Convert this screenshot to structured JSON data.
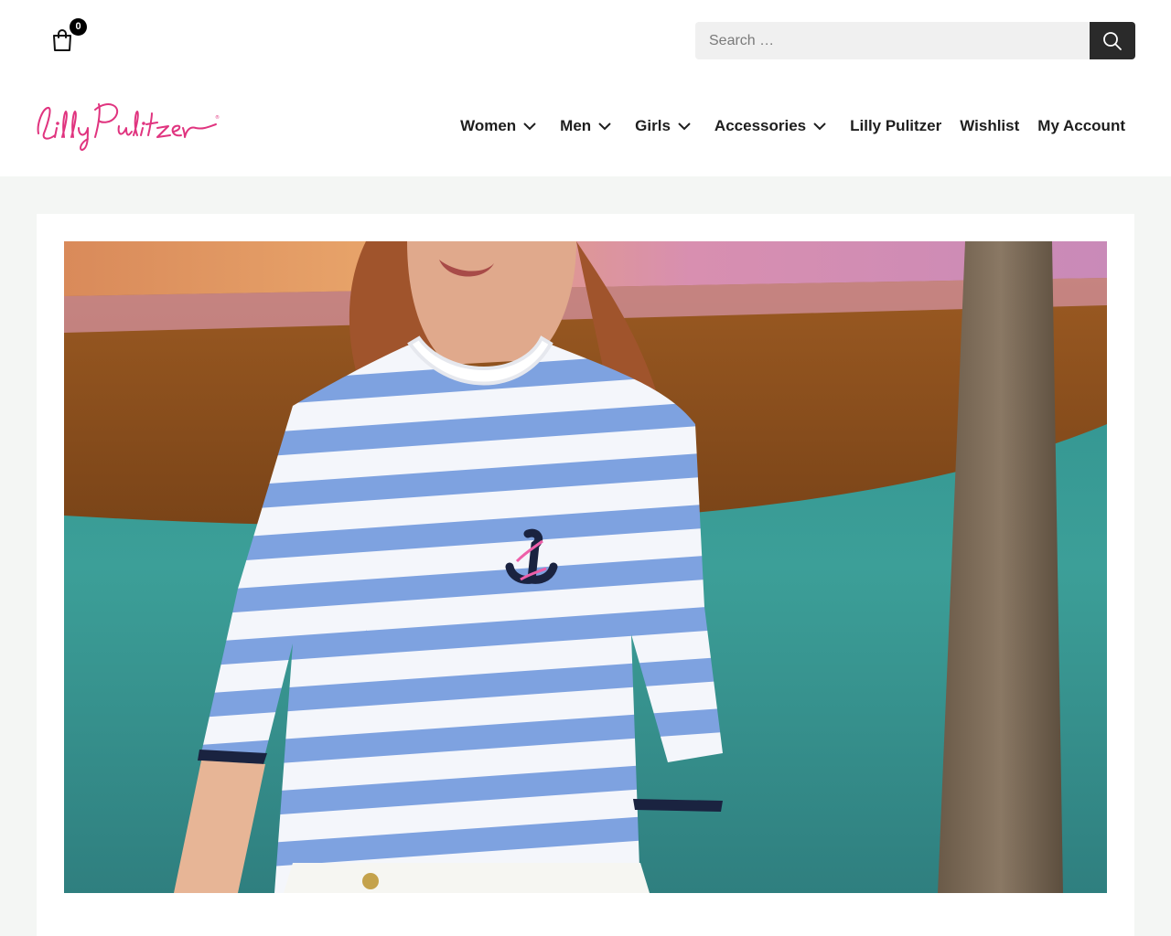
{
  "header": {
    "cart": {
      "count": "0",
      "icon": "shopping-bag-icon"
    },
    "search": {
      "placeholder": "Search …",
      "value": "",
      "button_icon": "search-icon"
    }
  },
  "brand": {
    "logo_text": "Lilly Pulitzer",
    "logo_color": "#e0347f"
  },
  "nav": {
    "items": [
      {
        "label": "Women",
        "has_dropdown": true
      },
      {
        "label": "Men",
        "has_dropdown": true
      },
      {
        "label": "Girls",
        "has_dropdown": true
      },
      {
        "label": "Accessories",
        "has_dropdown": true
      },
      {
        "label": "Lilly Pulitzer",
        "has_dropdown": false
      },
      {
        "label": "Wishlist",
        "has_dropdown": false
      },
      {
        "label": "My Account",
        "has_dropdown": false
      }
    ]
  },
  "hero": {
    "description": "Woman wearing a blue and white striped sweater with an embroidered navy anchor, standing by the water"
  },
  "colors": {
    "page_background": "#f4f6f4",
    "search_button": "#2a2a2a",
    "text": "#1e1e1e"
  }
}
